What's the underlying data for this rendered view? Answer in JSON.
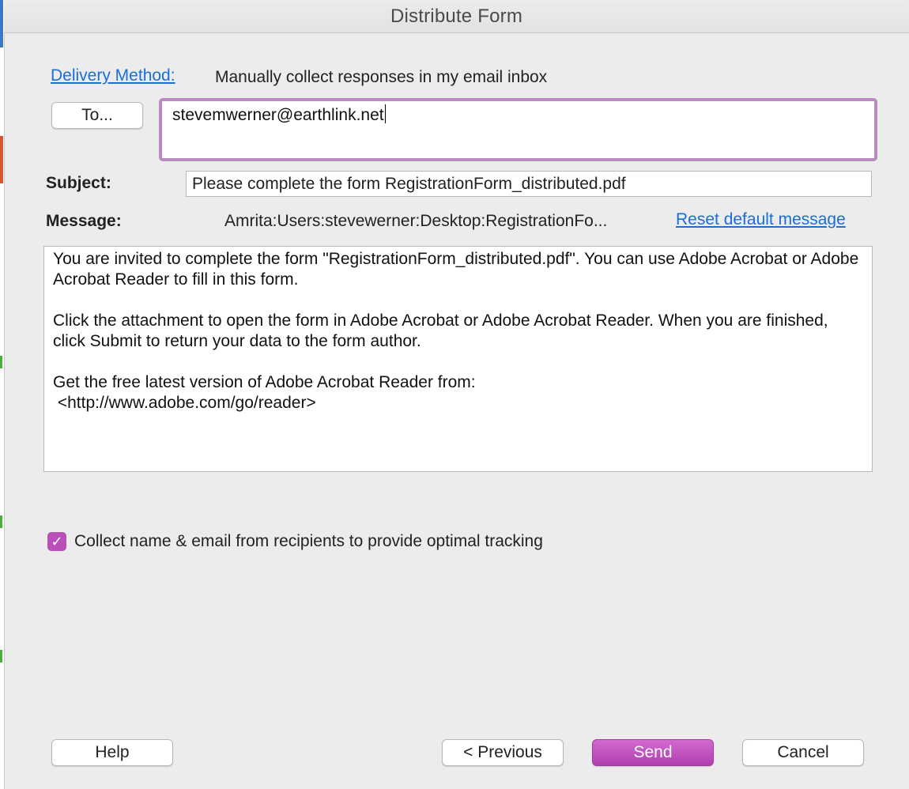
{
  "window": {
    "title": "Distribute Form"
  },
  "delivery": {
    "link_label": "Delivery Method:",
    "value": "Manually collect responses in my email inbox"
  },
  "to": {
    "button_label": "To...",
    "value": "stevemwerner@earthlink.net"
  },
  "subject": {
    "label": "Subject:",
    "value": "Please complete the form RegistrationForm_distributed.pdf"
  },
  "message": {
    "label": "Message:",
    "path": "Amrita:Users:stevewerner:Desktop:RegistrationFo...",
    "reset_link": "Reset default message",
    "paragraphs": [
      "You are invited to complete the form \"RegistrationForm_distributed.pdf\". You can use Adobe Acrobat or Adobe Acrobat Reader to fill in this form.",
      "Click the attachment to open the form in Adobe Acrobat or Adobe Acrobat Reader. When you are finished, click Submit to return your data to the form author.",
      "Get the free latest version of Adobe Acrobat Reader from:\n <http://www.adobe.com/go/reader>"
    ]
  },
  "tracking": {
    "checked": true,
    "check_glyph": "✓",
    "label": "Collect name & email from recipients to provide optimal tracking"
  },
  "buttons": {
    "help": "Help",
    "previous": "< Previous",
    "send": "Send",
    "cancel": "Cancel"
  },
  "colors": {
    "accent": "#b94fb7",
    "link": "#1a6fd6",
    "focus_ring": "#b98bc0"
  },
  "icons": {
    "checkbox": "checkmark-icon"
  }
}
